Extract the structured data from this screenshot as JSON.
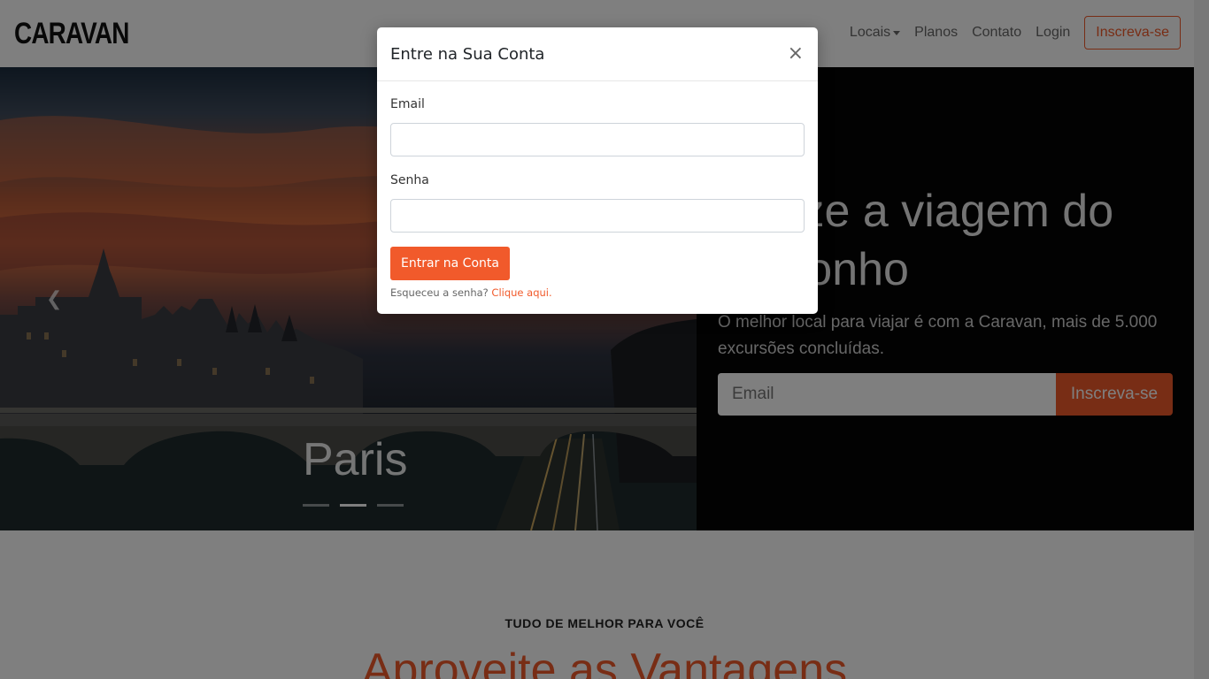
{
  "brand": {
    "name": "CARAVAN"
  },
  "nav": {
    "items": [
      {
        "label": "Locais",
        "dropdown": true
      },
      {
        "label": "Planos"
      },
      {
        "label": "Contato"
      },
      {
        "label": "Login"
      }
    ],
    "signup_label": "Inscreva-se"
  },
  "hero": {
    "slide_caption": "Paris",
    "slide_count": 3,
    "active_slide": 2,
    "prev_icon": "chevron-left-icon",
    "title": "Realize a viagem do seu sonho",
    "subtitle": "O melhor local para viajar é com a Caravan, mais de 5.000 excursões concluídas.",
    "email_placeholder": "Email",
    "signup_label": "Inscreva-se"
  },
  "section": {
    "eyebrow": "TUDO DE MELHOR PARA VOCÊ",
    "title": "Aproveite as Vantagens"
  },
  "modal": {
    "title": "Entre na Sua Conta",
    "close_icon": "close-icon",
    "email_label": "Email",
    "email_value": "",
    "password_label": "Senha",
    "password_value": "",
    "submit_label": "Entrar na Conta",
    "forgot_text": "Esqueceu a senha?",
    "forgot_link": "Clique aqui."
  },
  "colors": {
    "accent": "#f15a2b",
    "backdrop": "rgba(0,0,0,0.5)"
  }
}
